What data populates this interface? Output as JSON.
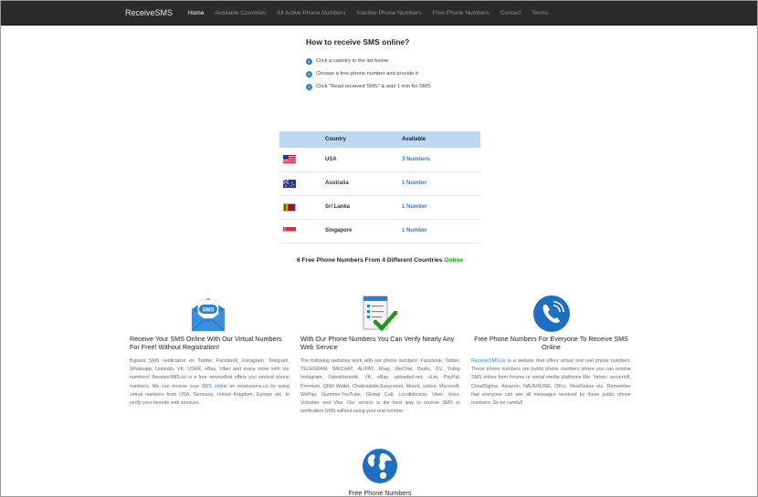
{
  "navbar": {
    "brand": "ReceiveSMS",
    "items": [
      {
        "label": "Home",
        "active": true
      },
      {
        "label": "Available Countries",
        "active": false
      },
      {
        "label": "All Active Phone Numbers",
        "active": false
      },
      {
        "label": "Inactive Phone Numbers",
        "active": false
      },
      {
        "label": "Free Phone Numbers",
        "active": false
      },
      {
        "label": "Contact",
        "active": false
      },
      {
        "label": "Terms",
        "active": false
      }
    ]
  },
  "howto": {
    "title": "How to receive SMS online?",
    "steps": [
      {
        "num": "1",
        "text": "Click a country in the list below"
      },
      {
        "num": "2",
        "text": "Choose a free phone number and provide it"
      },
      {
        "num": "3",
        "text": "Click \"Read received SMS\" & wait 1 min for SMS"
      }
    ]
  },
  "table": {
    "headers": [
      "Country",
      "Available"
    ],
    "rows": [
      {
        "country": "USA",
        "available": "3 Numbers"
      },
      {
        "country": "Australia",
        "available": "1 Number"
      },
      {
        "country": "Sri Lanka",
        "available": "1 Number"
      },
      {
        "country": "Singapore",
        "available": "1 Number"
      }
    ]
  },
  "summary": {
    "text": "6 Free Phone Numbers From 4 Different Countries",
    "online": "Online"
  },
  "features": {
    "col1": {
      "title": "Receive Your SMS Online With Our Virtual Numbers For Free! Without Registration!",
      "icon_label": "SMS",
      "text_before": "Bypass SMS verification on Twitter, Facebook, Instagram, Telegram, Whatsapp, Linkedin, VK, USER, eBay, Viber and many more with our numbers! ReceiveSMS.co is a free servicethat offers you several phone numbers. We can receive your",
      "link": "SMS online",
      "text_after": "on receivesms.co by using virtual numbers from USA, Germany, United Kingdom, Europe etc. to verify your favorite web services."
    },
    "col2": {
      "title": "With Our Phone Numbers You Can Verify Nearly Any Web Service",
      "text": "The following websites work with our phone numbers: Facebook, Twitter, TELEGRAM, WECHAT, ALIPAY, Ebay, WeChat, Baidu, GV, Yuilop Instagram, Odnoklassniki, VK, eBay, uploaded.net, ul.to, PayPal, Premium, QIWI Wallet, Chatroulette,Easycenet, Moent, yahoo, Microsoft, WePay, Gumtree,YouTube, Global Call, Localbitcoins, Uber, Voxo, Vichatter and Viss. Our service is the best way to receive SMS or verification SMS without using your real number."
    },
    "col3": {
      "title": "Free Phone Numbers For Everyone To Receive SMS Online",
      "link": "ReceiveSMS.co",
      "text": "is a website that offers virtual and real phone numbers. These phone numbers are public phone numbers where you can receive SMS online from forums or social media platforms like: Yahoo, serverloft, CloudSigma, Amazon, NAVERLINE, OKru, RealStatus etc. Remember that everyone can see all messages received by these public phone numbers. So be careful!"
    },
    "col4": {
      "title": "Free Phone Numbers"
    }
  },
  "colors": {
    "navbar_bg": "#2b2b2b",
    "accent_blue": "#2a7fd4",
    "table_header_bg": "#bcd9f4",
    "online_green": "#1a9a1a"
  }
}
